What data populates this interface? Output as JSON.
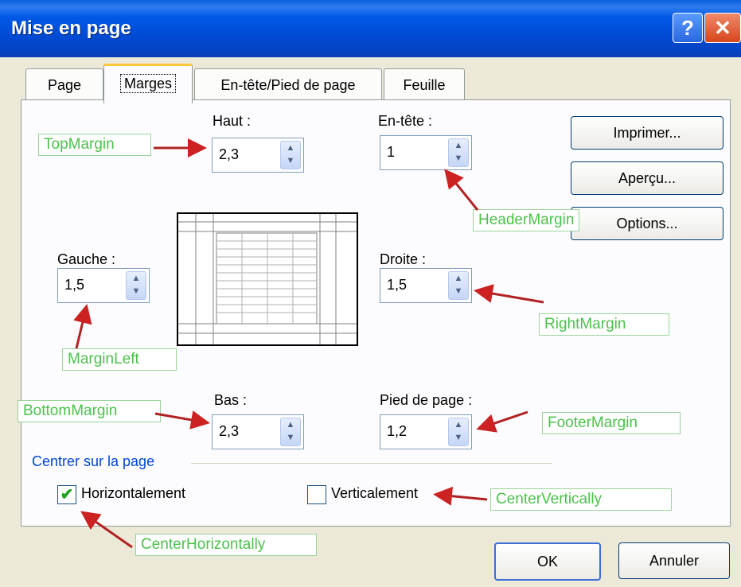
{
  "window": {
    "title": "Mise en page",
    "help_glyph": "?",
    "close_glyph": "✕"
  },
  "tabs": [
    {
      "label": "Page",
      "active": false
    },
    {
      "label": "Marges",
      "active": true
    },
    {
      "label": "En-tête/Pied de page",
      "active": false
    },
    {
      "label": "Feuille",
      "active": false
    }
  ],
  "fields": {
    "top": {
      "label": "Haut :",
      "value": "2,3"
    },
    "header": {
      "label": "En-tête :",
      "value": "1"
    },
    "left": {
      "label": "Gauche :",
      "value": "1,5"
    },
    "right": {
      "label": "Droite :",
      "value": "1,5"
    },
    "bottom": {
      "label": "Bas :",
      "value": "2,3"
    },
    "footer": {
      "label": "Pied de page :",
      "value": "1,2"
    }
  },
  "buttons": {
    "print": "Imprimer...",
    "preview": "Aperçu...",
    "options": "Options...",
    "ok": "OK",
    "cancel": "Annuler"
  },
  "center": {
    "group_label": "Centrer sur la page",
    "horizontal": {
      "label": "Horizontalement",
      "checked": true
    },
    "vertical": {
      "label": "Verticalement",
      "checked": false
    }
  },
  "annotations": {
    "top": "TopMargin",
    "header": "HeaderMargin",
    "left": "MarginLeft",
    "right": "RightMargin",
    "bottom": "BottomMargin",
    "footer": "FooterMargin",
    "center_h": "CenterHorizontally",
    "center_v": "CenterVertically"
  },
  "colors": {
    "title_bar": "#0058e6",
    "annotation_text": "#4bc24b",
    "arrow": "#cc2222",
    "group_label": "#0046d5"
  }
}
